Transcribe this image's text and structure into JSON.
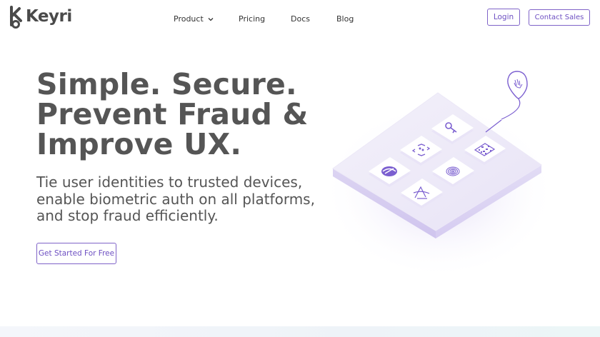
{
  "brand": {
    "name": "Keyri",
    "accent": "#6d4fc2"
  },
  "nav": {
    "items": [
      {
        "label": "Product",
        "has_dropdown": true,
        "icon": "chevron-down-icon"
      },
      {
        "label": "Pricing"
      },
      {
        "label": "Docs"
      },
      {
        "label": "Blog"
      }
    ],
    "login_label": "Login",
    "contact_label": "Contact Sales"
  },
  "hero": {
    "title_lines": [
      "Simple. Secure.",
      "Prevent Fraud &",
      "Improve UX."
    ],
    "subtitle_lines": [
      "Tie user identities to trusted devices,",
      "enable biometric auth on all platforms,",
      "and stop fraud efficiently."
    ],
    "cta_label": "Get Started For Free"
  },
  "illustration": {
    "tiles": [
      "key-icon",
      "qr-code-icon",
      "face-scan-icon",
      "fingerprint-icon",
      "shield-eye-icon",
      "signature-icon"
    ],
    "pin": "location-pin-hand-icon"
  }
}
